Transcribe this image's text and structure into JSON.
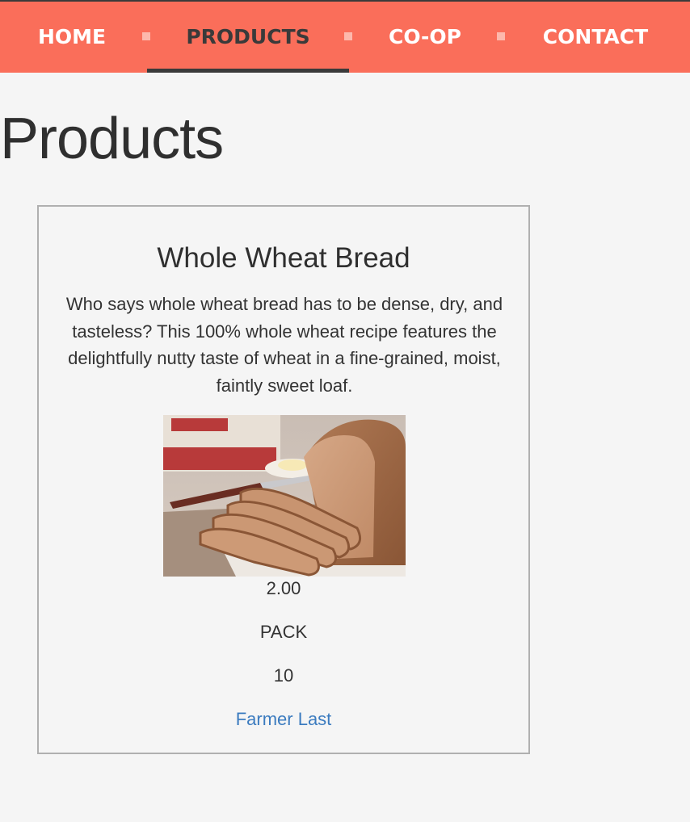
{
  "nav": {
    "items": [
      {
        "label": "HOME"
      },
      {
        "label": "PRODUCTS"
      },
      {
        "label": "CO-OP"
      },
      {
        "label": "CONTACT"
      }
    ],
    "active": "PRODUCTS"
  },
  "page": {
    "title": "Products"
  },
  "product": {
    "name": "Whole Wheat Bread",
    "description": "Who says whole wheat bread has to be dense, dry, and tasteless? This 100% whole wheat recipe features the delightfully nutty taste of wheat in a fine-grained, moist, faintly sweet loaf.",
    "price": "2.00",
    "unit": "PACK",
    "quantity": "10",
    "farmer": "Farmer Last"
  },
  "colors": {
    "nav_background": "#fa6e5a",
    "nav_text": "#ffffff",
    "nav_active_text": "#3a3a3a",
    "page_background": "#f5f5f5",
    "link": "#3b7bbf"
  }
}
